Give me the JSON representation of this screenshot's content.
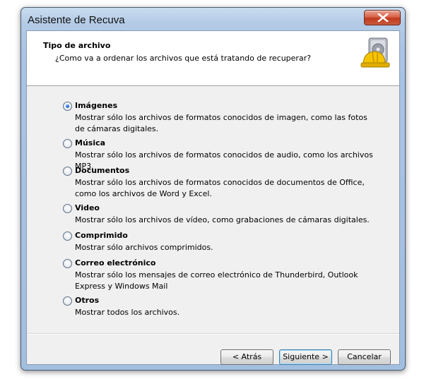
{
  "window": {
    "title": "Asistente de Recuva"
  },
  "header": {
    "title": "Tipo de archivo",
    "subtitle": "¿Como va a ordenar los archivos que está tratando de recuperar?",
    "icon": "recuva-helmet-drive-icon"
  },
  "options": [
    {
      "label": "Imágenes",
      "description": "Mostrar sólo los archivos de formatos conocidos de imagen, como las fotos de cámaras digitales.",
      "selected": true
    },
    {
      "label": "Música",
      "description": "Mostrar sólo los archivos de formatos conocidos de audio, como los archivos MP3.",
      "selected": false
    },
    {
      "label": "Documentos",
      "description": "Mostrar sólo los archivos de formatos conocidos de documentos de Office, como los archivos de Word y Excel.",
      "selected": false
    },
    {
      "label": "Video",
      "description": "Mostrar sólo los archivos de vídeo, como grabaciones de cámaras digitales.",
      "selected": false
    },
    {
      "label": "Comprimido",
      "description": "Mostrar sólo archivos comprimidos.",
      "selected": false
    },
    {
      "label": "Correo electrónico",
      "description": "Mostrar sólo los mensajes de correo electrónico de Thunderbird, Outlook Express y Windows Mail",
      "selected": false
    },
    {
      "label": "Otros",
      "description": "Mostrar todos los archivos.",
      "selected": false
    }
  ],
  "buttons": {
    "back": "< Atrás",
    "next": "Siguiente >",
    "cancel": "Cancelar"
  }
}
